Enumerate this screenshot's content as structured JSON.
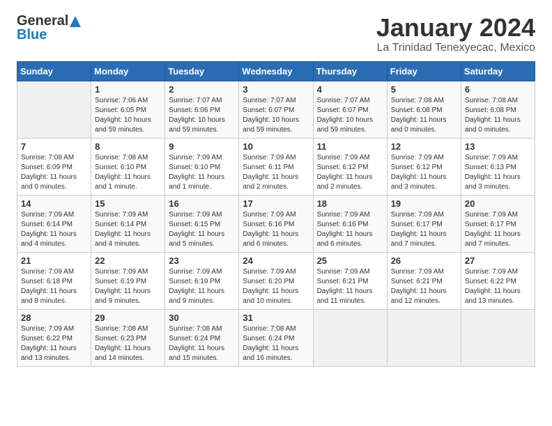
{
  "logo": {
    "general": "General",
    "blue": "Blue"
  },
  "title": "January 2024",
  "location": "La Trinidad Tenexyecac, Mexico",
  "weekdays": [
    "Sunday",
    "Monday",
    "Tuesday",
    "Wednesday",
    "Thursday",
    "Friday",
    "Saturday"
  ],
  "weeks": [
    [
      {
        "day": "",
        "sunrise": "",
        "sunset": "",
        "daylight": ""
      },
      {
        "day": "1",
        "sunrise": "Sunrise: 7:06 AM",
        "sunset": "Sunset: 6:05 PM",
        "daylight": "Daylight: 10 hours and 59 minutes."
      },
      {
        "day": "2",
        "sunrise": "Sunrise: 7:07 AM",
        "sunset": "Sunset: 6:06 PM",
        "daylight": "Daylight: 10 hours and 59 minutes."
      },
      {
        "day": "3",
        "sunrise": "Sunrise: 7:07 AM",
        "sunset": "Sunset: 6:07 PM",
        "daylight": "Daylight: 10 hours and 59 minutes."
      },
      {
        "day": "4",
        "sunrise": "Sunrise: 7:07 AM",
        "sunset": "Sunset: 6:07 PM",
        "daylight": "Daylight: 10 hours and 59 minutes."
      },
      {
        "day": "5",
        "sunrise": "Sunrise: 7:08 AM",
        "sunset": "Sunset: 6:08 PM",
        "daylight": "Daylight: 11 hours and 0 minutes."
      },
      {
        "day": "6",
        "sunrise": "Sunrise: 7:08 AM",
        "sunset": "Sunset: 6:08 PM",
        "daylight": "Daylight: 11 hours and 0 minutes."
      }
    ],
    [
      {
        "day": "7",
        "sunrise": "Sunrise: 7:08 AM",
        "sunset": "Sunset: 6:09 PM",
        "daylight": "Daylight: 11 hours and 0 minutes."
      },
      {
        "day": "8",
        "sunrise": "Sunrise: 7:08 AM",
        "sunset": "Sunset: 6:10 PM",
        "daylight": "Daylight: 11 hours and 1 minute."
      },
      {
        "day": "9",
        "sunrise": "Sunrise: 7:09 AM",
        "sunset": "Sunset: 6:10 PM",
        "daylight": "Daylight: 11 hours and 1 minute."
      },
      {
        "day": "10",
        "sunrise": "Sunrise: 7:09 AM",
        "sunset": "Sunset: 6:11 PM",
        "daylight": "Daylight: 11 hours and 2 minutes."
      },
      {
        "day": "11",
        "sunrise": "Sunrise: 7:09 AM",
        "sunset": "Sunset: 6:12 PM",
        "daylight": "Daylight: 11 hours and 2 minutes."
      },
      {
        "day": "12",
        "sunrise": "Sunrise: 7:09 AM",
        "sunset": "Sunset: 6:12 PM",
        "daylight": "Daylight: 11 hours and 3 minutes."
      },
      {
        "day": "13",
        "sunrise": "Sunrise: 7:09 AM",
        "sunset": "Sunset: 6:13 PM",
        "daylight": "Daylight: 11 hours and 3 minutes."
      }
    ],
    [
      {
        "day": "14",
        "sunrise": "Sunrise: 7:09 AM",
        "sunset": "Sunset: 6:14 PM",
        "daylight": "Daylight: 11 hours and 4 minutes."
      },
      {
        "day": "15",
        "sunrise": "Sunrise: 7:09 AM",
        "sunset": "Sunset: 6:14 PM",
        "daylight": "Daylight: 11 hours and 4 minutes."
      },
      {
        "day": "16",
        "sunrise": "Sunrise: 7:09 AM",
        "sunset": "Sunset: 6:15 PM",
        "daylight": "Daylight: 11 hours and 5 minutes."
      },
      {
        "day": "17",
        "sunrise": "Sunrise: 7:09 AM",
        "sunset": "Sunset: 6:16 PM",
        "daylight": "Daylight: 11 hours and 6 minutes."
      },
      {
        "day": "18",
        "sunrise": "Sunrise: 7:09 AM",
        "sunset": "Sunset: 6:16 PM",
        "daylight": "Daylight: 11 hours and 6 minutes."
      },
      {
        "day": "19",
        "sunrise": "Sunrise: 7:09 AM",
        "sunset": "Sunset: 6:17 PM",
        "daylight": "Daylight: 11 hours and 7 minutes."
      },
      {
        "day": "20",
        "sunrise": "Sunrise: 7:09 AM",
        "sunset": "Sunset: 6:17 PM",
        "daylight": "Daylight: 11 hours and 7 minutes."
      }
    ],
    [
      {
        "day": "21",
        "sunrise": "Sunrise: 7:09 AM",
        "sunset": "Sunset: 6:18 PM",
        "daylight": "Daylight: 11 hours and 8 minutes."
      },
      {
        "day": "22",
        "sunrise": "Sunrise: 7:09 AM",
        "sunset": "Sunset: 6:19 PM",
        "daylight": "Daylight: 11 hours and 9 minutes."
      },
      {
        "day": "23",
        "sunrise": "Sunrise: 7:09 AM",
        "sunset": "Sunset: 6:19 PM",
        "daylight": "Daylight: 11 hours and 9 minutes."
      },
      {
        "day": "24",
        "sunrise": "Sunrise: 7:09 AM",
        "sunset": "Sunset: 6:20 PM",
        "daylight": "Daylight: 11 hours and 10 minutes."
      },
      {
        "day": "25",
        "sunrise": "Sunrise: 7:09 AM",
        "sunset": "Sunset: 6:21 PM",
        "daylight": "Daylight: 11 hours and 11 minutes."
      },
      {
        "day": "26",
        "sunrise": "Sunrise: 7:09 AM",
        "sunset": "Sunset: 6:21 PM",
        "daylight": "Daylight: 11 hours and 12 minutes."
      },
      {
        "day": "27",
        "sunrise": "Sunrise: 7:09 AM",
        "sunset": "Sunset: 6:22 PM",
        "daylight": "Daylight: 11 hours and 13 minutes."
      }
    ],
    [
      {
        "day": "28",
        "sunrise": "Sunrise: 7:09 AM",
        "sunset": "Sunset: 6:22 PM",
        "daylight": "Daylight: 11 hours and 13 minutes."
      },
      {
        "day": "29",
        "sunrise": "Sunrise: 7:08 AM",
        "sunset": "Sunset: 6:23 PM",
        "daylight": "Daylight: 11 hours and 14 minutes."
      },
      {
        "day": "30",
        "sunrise": "Sunrise: 7:08 AM",
        "sunset": "Sunset: 6:24 PM",
        "daylight": "Daylight: 11 hours and 15 minutes."
      },
      {
        "day": "31",
        "sunrise": "Sunrise: 7:08 AM",
        "sunset": "Sunset: 6:24 PM",
        "daylight": "Daylight: 11 hours and 16 minutes."
      },
      {
        "day": "",
        "sunrise": "",
        "sunset": "",
        "daylight": ""
      },
      {
        "day": "",
        "sunrise": "",
        "sunset": "",
        "daylight": ""
      },
      {
        "day": "",
        "sunrise": "",
        "sunset": "",
        "daylight": ""
      }
    ]
  ]
}
